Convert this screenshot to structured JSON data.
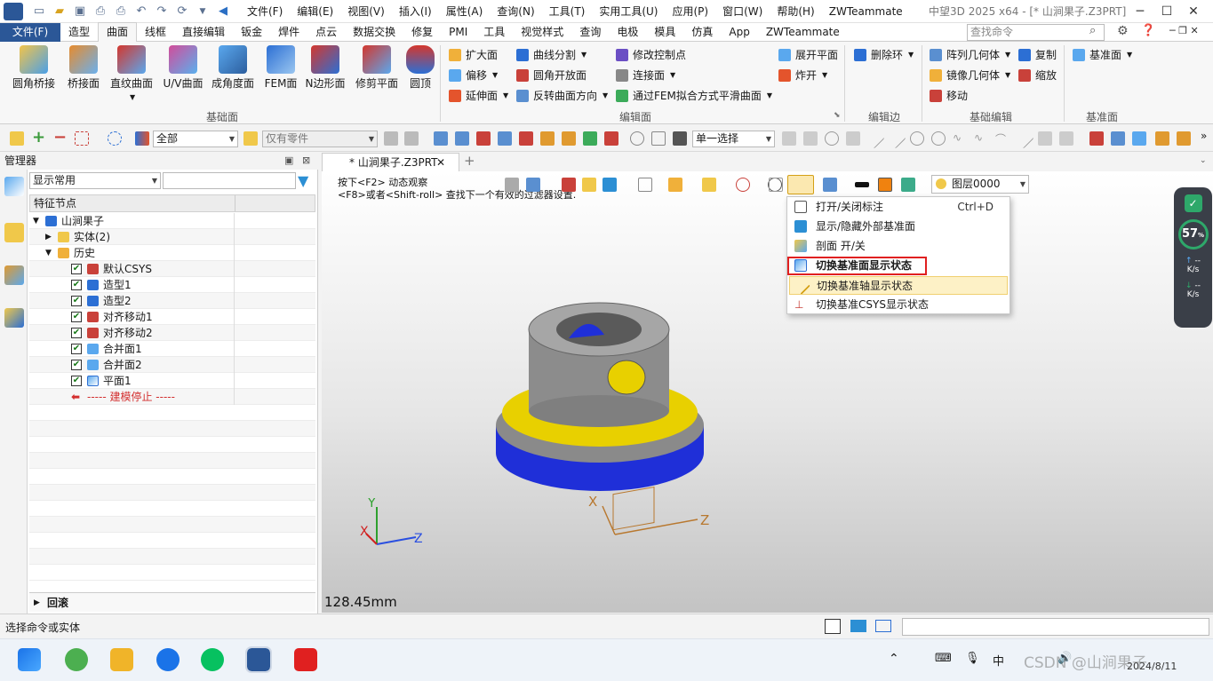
{
  "title_bar": {
    "app_title": "中望3D 2025 x64 - [* 山涧果子.Z3PRT]",
    "menus": [
      "文件(F)",
      "编辑(E)",
      "视图(V)",
      "插入(I)",
      "属性(A)",
      "查询(N)",
      "工具(T)",
      "实用工具(U)",
      "应用(P)",
      "窗口(W)",
      "帮助(H)",
      "ZWTeammate"
    ]
  },
  "ribbon_tabs": {
    "items": [
      "文件(F)",
      "造型",
      "曲面",
      "线框",
      "直接编辑",
      "钣金",
      "焊件",
      "点云",
      "数据交换",
      "修复",
      "PMI",
      "工具",
      "视觉样式",
      "查询",
      "电极",
      "模具",
      "仿真",
      "App",
      "ZWTeammate"
    ],
    "active": "曲面",
    "search_placeholder": "查找命令"
  },
  "ribbon": {
    "group1": {
      "label": "基础面",
      "buttons": [
        "圆角桥接",
        "桥接面",
        "直纹曲面",
        "U/V曲面",
        "成角度面",
        "FEM面",
        "N边形面",
        "修剪平面",
        "圆顶"
      ]
    },
    "group2": {
      "label": "编辑面",
      "col1": [
        "扩大面",
        "偏移",
        "延伸面"
      ],
      "col2": [
        "曲线分割",
        "圆角开放面",
        "反转曲面方向"
      ],
      "col3": [
        "修改控制点",
        "连接面",
        "通过FEM拟合方式平滑曲面"
      ],
      "col4": [
        "展开平面",
        "炸开"
      ]
    },
    "group3": {
      "label": "编辑边",
      "item": "删除环"
    },
    "group4": {
      "label": "基础编辑",
      "col1": [
        "阵列几何体",
        "镜像几何体",
        "移动"
      ],
      "col2": [
        "复制",
        "缩放"
      ]
    },
    "group5": {
      "label": "基准面",
      "item": "基准面"
    }
  },
  "toolbar2": {
    "filter_value": "全部",
    "part_value": "仅有零件",
    "select_mode": "单一选择"
  },
  "manager": {
    "title": "管理器",
    "display_combo": "显示常用",
    "tree_header": "特征节点",
    "tree": [
      {
        "label": "山涧果子",
        "level": 0,
        "check": false
      },
      {
        "label": "实体(2)",
        "level": 1,
        "check": false
      },
      {
        "label": "历史",
        "level": 1,
        "check": false
      },
      {
        "label": "默认CSYS",
        "level": 2,
        "check": true
      },
      {
        "label": "造型1",
        "level": 2,
        "check": true
      },
      {
        "label": "造型2",
        "level": 2,
        "check": true
      },
      {
        "label": "对齐移动1",
        "level": 2,
        "check": true
      },
      {
        "label": "对齐移动2",
        "level": 2,
        "check": true
      },
      {
        "label": "合并面1",
        "level": 2,
        "check": true
      },
      {
        "label": "合并面2",
        "level": 2,
        "check": true
      },
      {
        "label": "平面1",
        "level": 2,
        "check": true
      }
    ],
    "stop_marker": "----- 建模停止 -----",
    "rollback": "回滚"
  },
  "viewport": {
    "doc_tab": "* 山涧果子.Z3PRT",
    "hint_line1": "按下<F2> 动态观察",
    "hint_line2": "<F8>或者<Shift-roll> 查找下一个有效的过滤器设置.",
    "layer": "图层0000",
    "scale_text": "128.45mm",
    "axis_labels": {
      "x": "X",
      "y": "Y",
      "z": "Z"
    }
  },
  "dropdown": {
    "items": [
      {
        "label": "打开/关闭标注",
        "shortcut": "Ctrl+D"
      },
      {
        "label": "显示/隐藏外部基准面",
        "shortcut": ""
      },
      {
        "label": "剖面 开/关",
        "shortcut": ""
      },
      {
        "label": "切换基准面显示状态",
        "shortcut": ""
      },
      {
        "label": "切换基准轴显示状态",
        "shortcut": ""
      },
      {
        "label": "切换基准CSYS显示状态",
        "shortcut": ""
      }
    ]
  },
  "monitor": {
    "percent": "57",
    "unit": "%",
    "up": "--",
    "up_unit": "K/s",
    "down": "--",
    "down_unit": "K/s"
  },
  "status": {
    "text": "选择命令或实体"
  },
  "taskbar": {
    "time": "2024/8/11",
    "watermark": "CSDN @山涧果子"
  }
}
